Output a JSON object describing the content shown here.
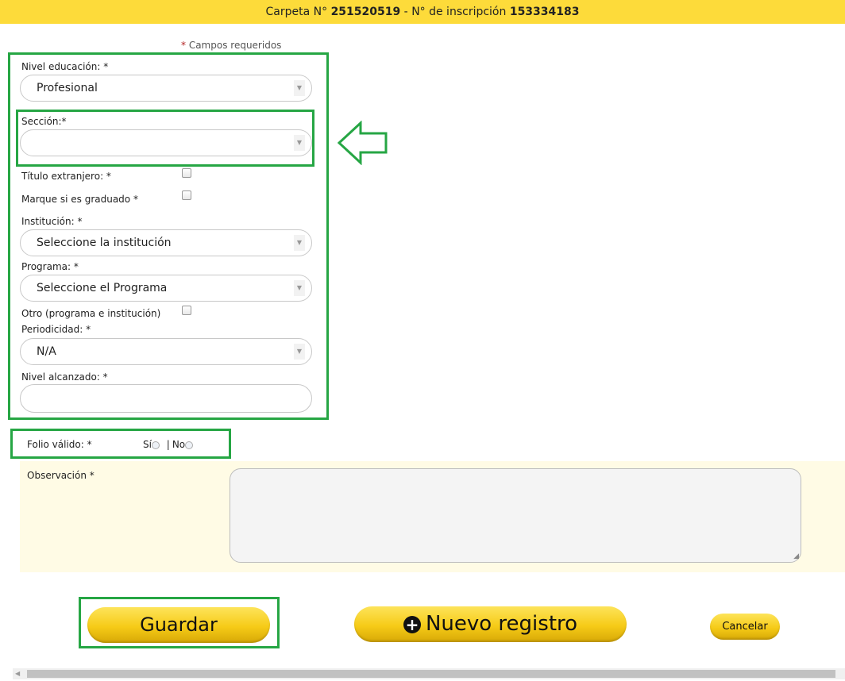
{
  "header": {
    "carpeta_label": "Carpeta N°",
    "carpeta_number": "251520519",
    "separator": " - ",
    "inscripcion_label": "N° de inscripción",
    "inscripcion_number": "153334183"
  },
  "required_note": {
    "star": "*",
    "text": "Campos requeridos"
  },
  "form": {
    "nivel_educacion": {
      "label": "Nivel educación: *",
      "value": "Profesional"
    },
    "seccion": {
      "label": "Sección:*",
      "value": ""
    },
    "titulo_extranjero": {
      "label": "Título extranjero: *",
      "checked": false
    },
    "graduado": {
      "label": "Marque si es graduado *",
      "checked": false
    },
    "institucion": {
      "label": "Institución: *",
      "value": "Seleccione la institución"
    },
    "programa": {
      "label": "Programa: *",
      "value": "Seleccione el Programa"
    },
    "otro": {
      "label": "Otro (programa e institución)",
      "checked": false
    },
    "periodicidad": {
      "label": "Periodicidad: *",
      "value": "N/A"
    },
    "nivel_alcanzado": {
      "label": "Nivel alcanzado: *",
      "value": ""
    }
  },
  "folio": {
    "label": "Folio válido: *",
    "yes": "Sí",
    "divider": "|",
    "no": "No"
  },
  "observacion": {
    "label": "Observación *",
    "value": ""
  },
  "buttons": {
    "guardar": "Guardar",
    "nuevo": "Nuevo registro",
    "cancelar": "Cancelar"
  },
  "icons": {
    "dropdown": "chevron-down-icon",
    "plus": "plus-circle-icon",
    "arrow": "left-arrow-icon"
  },
  "colors": {
    "header_bg": "#fddb3a",
    "highlight": "#26a644",
    "panel_bg": "#fffbe5"
  }
}
